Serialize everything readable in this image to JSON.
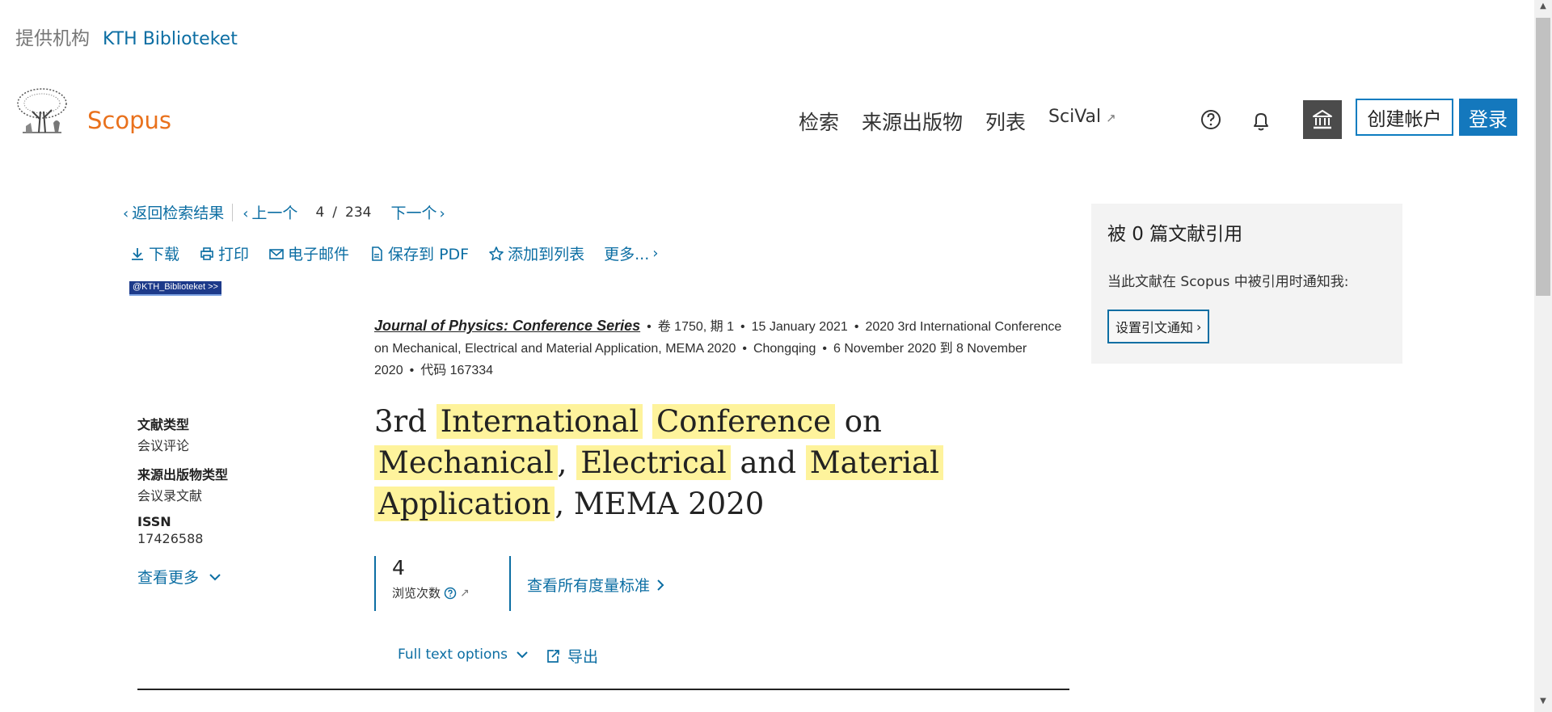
{
  "provider": {
    "label": "提供机构",
    "name": "KTH Biblioteket"
  },
  "header": {
    "brand": "Scopus",
    "nav": [
      {
        "label": "检索"
      },
      {
        "label": "来源出版物"
      },
      {
        "label": "列表"
      }
    ],
    "scival": {
      "label": "SciVal",
      "arrow": "↗"
    },
    "create_account": "创建帐户",
    "login": "登录"
  },
  "pager": {
    "back": "返回检索结果",
    "prev": "上一个",
    "current": "4",
    "slash": "/",
    "total": "234",
    "next": "下一个"
  },
  "toolbar": {
    "download": "下载",
    "print": "打印",
    "email": "电子邮件",
    "save_pdf": "保存到 PDF",
    "add_list": "添加到列表",
    "more": "更多..."
  },
  "kth_badge": "@KTH_Biblioteket >>",
  "source": {
    "journal": "Journal of Physics: Conference Series",
    "volume": "卷 1750, 期 1",
    "date": "15 January 2021",
    "conference": "2020 3rd International Conference on Mechanical, Electrical and Material Application, MEMA 2020",
    "city": "Chongqing",
    "conf_dates": "6 November 2020 到 8 November 2020",
    "code": "代码 167334"
  },
  "meta": {
    "doc_type_label": "文献类型",
    "doc_type_value": "会议评论",
    "source_type_label": "来源出版物类型",
    "source_type_value": "会议录文献",
    "issn_label": "ISSN",
    "issn_value": "17426588",
    "see_more": "查看更多"
  },
  "title_parts": {
    "t1": "3rd",
    "t2": "International",
    "t3": "Conference",
    "t4": "on",
    "t5": "Mechanical",
    "t6": ",",
    "t7": "Electrical",
    "t8": "and",
    "t9": "Material",
    "t10": "Application",
    "t11": ", MEMA 2020"
  },
  "metrics": {
    "views": "4",
    "views_label": "浏览次数",
    "all_metrics": "查看所有度量标准"
  },
  "actions": {
    "full_text": "Full text options",
    "export": "导出"
  },
  "cite_panel": {
    "title": "被 0 篇文献引用",
    "desc": "当此文献在 Scopus 中被引用时通知我:",
    "button": "设置引文通知"
  },
  "colors": {
    "brand": "#e9711c",
    "link": "#0c6ea3",
    "highlight": "#fef39c",
    "login_bg": "#1478bd"
  }
}
